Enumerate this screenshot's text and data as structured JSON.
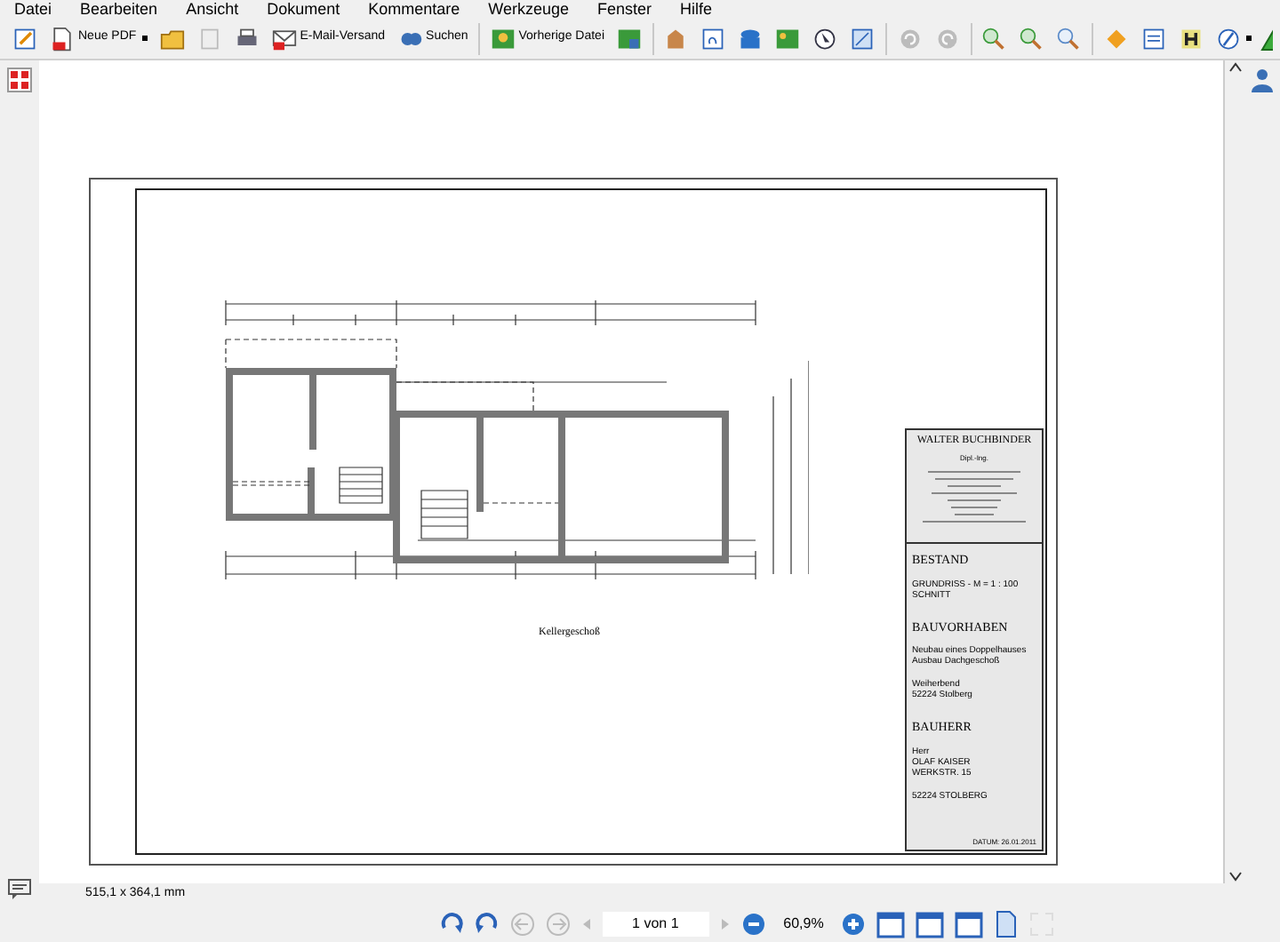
{
  "menu": [
    "Datei",
    "Bearbeiten",
    "Ansicht",
    "Dokument",
    "Kommentare",
    "Werkzeuge",
    "Fenster",
    "Hilfe"
  ],
  "toolbar": [
    {
      "kind": "icon",
      "disabled": false
    },
    {
      "kind": "labeled",
      "label": "Neue PDF",
      "dropdown": true,
      "disabled": false
    },
    {
      "kind": "icon",
      "disabled": false
    },
    {
      "kind": "icon",
      "disabled": true
    },
    {
      "kind": "icon",
      "disabled": false
    },
    {
      "kind": "labeled",
      "label": "E-Mail-Versand",
      "disabled": false
    },
    {
      "kind": "labeled",
      "label": "Suchen",
      "disabled": false
    },
    {
      "kind": "separator"
    },
    {
      "kind": "labeled",
      "label": "Vorherige Datei",
      "disabled": false
    },
    {
      "kind": "icon",
      "disabled": false
    },
    {
      "kind": "separator"
    },
    {
      "kind": "icon",
      "disabled": false
    },
    {
      "kind": "icon",
      "disabled": false
    },
    {
      "kind": "icon",
      "disabled": false
    },
    {
      "kind": "icon",
      "disabled": false
    },
    {
      "kind": "icon",
      "disabled": false
    },
    {
      "kind": "icon",
      "disabled": false
    },
    {
      "kind": "separator"
    },
    {
      "kind": "icon",
      "disabled": true
    },
    {
      "kind": "icon",
      "disabled": true
    },
    {
      "kind": "separator"
    },
    {
      "kind": "icon",
      "disabled": false
    },
    {
      "kind": "icon",
      "disabled": false
    },
    {
      "kind": "icon",
      "disabled": false
    },
    {
      "kind": "separator"
    },
    {
      "kind": "icon",
      "disabled": false
    },
    {
      "kind": "icon",
      "disabled": false
    },
    {
      "kind": "icon",
      "disabled": false
    },
    {
      "kind": "icon",
      "disabled": false,
      "dropdown": true
    }
  ],
  "drawing": {
    "caption": "Kellergeschoß",
    "title_block": {
      "architect": "WALTER BUCHBINDER",
      "degree": "Dipl.-Ing.",
      "sections": [
        {
          "heading": "BESTAND",
          "groups": [
            [
              "GRUNDRISS -  M = 1 : 100",
              "SCHNITT"
            ]
          ]
        },
        {
          "heading": "BAUVORHABEN",
          "groups": [
            [
              "Neubau eines Doppelhauses",
              "Ausbau Dachgeschoß"
            ],
            [
              "Weiherbend",
              "52224 Stolberg"
            ]
          ]
        },
        {
          "heading": "BAUHERR",
          "groups": [
            [
              "Herr",
              "OLAF KAISER",
              "WERKSTR. 15"
            ],
            [
              "52224 STOLBERG"
            ]
          ]
        }
      ],
      "date": "DATUM: 26.01.2011"
    }
  },
  "status_bar": {
    "page_size": "515,1 x 364,1 mm"
  },
  "navigation": {
    "page": "1 von 1",
    "zoom": "60,9%"
  }
}
